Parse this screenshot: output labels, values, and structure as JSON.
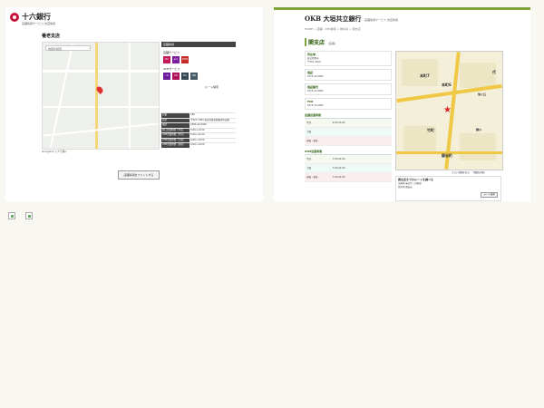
{
  "juroku": {
    "brand": "十六銀行",
    "brand_sub": "店舗情報サービス 支店情報",
    "branch_name": "養老支店",
    "map_search_placeholder": "地図を検索",
    "map_link": "Googleマップで開く",
    "print_button": "店舗情報をプリントする",
    "side_header": "店舗情報",
    "services_title": "店舗サービス",
    "atm_services_title": "ATMサービス",
    "route_link": "ルート検索",
    "services": [
      {
        "label": "窓口",
        "color": "#c2185b"
      },
      {
        "label": "ATM",
        "color": "#7b1fa2"
      },
      {
        "label": "駐車場",
        "color": "#c62828"
      }
    ],
    "atm_services": [
      {
        "label": "入金",
        "color": "#6a1b9a"
      },
      {
        "label": "出金",
        "color": "#ad1457"
      },
      {
        "label": "振込",
        "color": "#37474f"
      },
      {
        "label": "通帳",
        "color": "#455a64"
      }
    ],
    "info_rows": [
      {
        "k": "店番",
        "v": "280"
      },
      {
        "k": "住所",
        "v": "〒503-1383 岐阜県養老郡養老町高田"
      },
      {
        "k": "電話",
        "v": "0584-32-0000"
      },
      {
        "k": "窓口営業時間（平日）",
        "v": "9:00～15:00"
      },
      {
        "k": "ATM営業時間（平日）",
        "v": "8:00～21:00"
      },
      {
        "k": "ATM営業時間（土曜）",
        "v": "9:00～19:00"
      },
      {
        "k": "ATM営業時間（日祝）",
        "v": "9:00～19:00"
      }
    ]
  },
  "okb": {
    "brand": "OKB 大垣共立銀行",
    "brand_sub": "店舗情報サービス 支店情報",
    "breadcrumb": "HOME > 店舗・ATM検索 > 岐阜県 > 関支店",
    "branch_name": "関支店",
    "branch_code": "（店番）",
    "blocks": [
      {
        "h": "所在地",
        "lines": [
          "岐阜県関市",
          "〒501-3000"
        ]
      },
      {
        "h": "電話",
        "lines": [
          "0575-22-0000"
        ]
      },
      {
        "h": "電話番号",
        "lines": [
          "0575-22-0000"
        ]
      },
      {
        "h": "FAX",
        "lines": [
          "0575-22-0000"
        ]
      }
    ],
    "hours_title": "店舗営業時間",
    "hours": [
      {
        "k": "平日",
        "v": "9:00-15:00"
      },
      {
        "k": "土曜",
        "v": ""
      },
      {
        "k": "日曜・祝日",
        "v": ""
      }
    ],
    "atm_title": "ATM営業時間",
    "atm_hours": [
      {
        "k": "平日",
        "v": "7:00-21:00"
      },
      {
        "k": "土曜",
        "v": "7:00-21:00"
      },
      {
        "k": "日曜・祝日",
        "v": "7:00-21:00"
      }
    ],
    "map_labels": [
      "本町7",
      "本町6",
      "代",
      "旭ヶ丘",
      "竹町",
      "錦川",
      "錦谷町"
    ],
    "map_links": [
      "大きい地図を見る",
      "地図を印刷"
    ],
    "route_title": "関支店までのルートを調べる",
    "route_lines": [
      "出発地  ◉徒歩  ○自動車",
      "目的地  関支店"
    ],
    "route_button": "ルート検索"
  }
}
